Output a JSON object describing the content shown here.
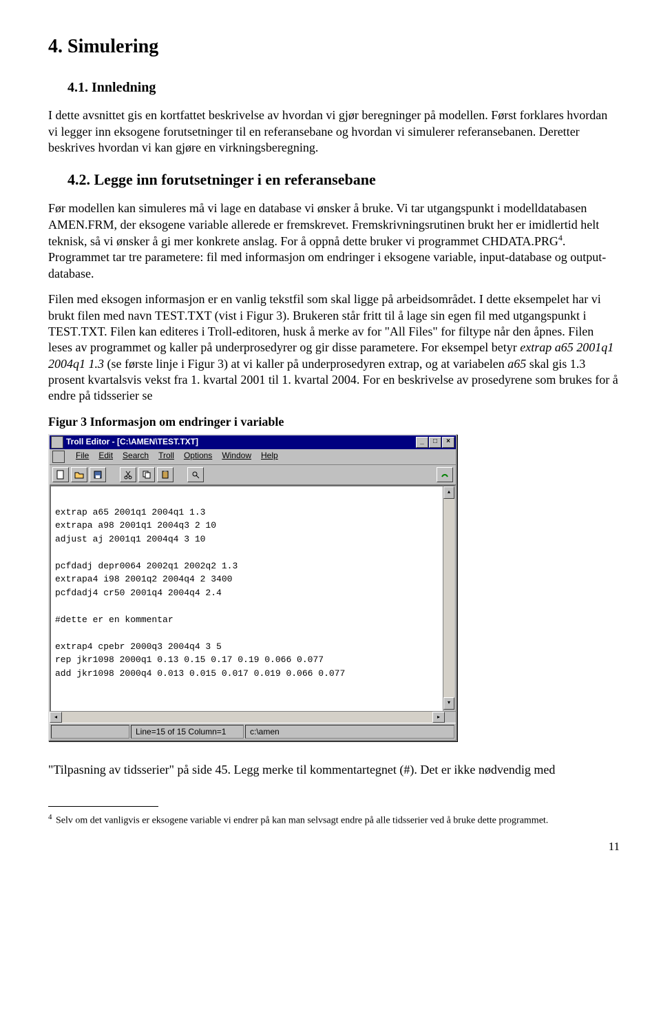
{
  "h1": "4. Simulering",
  "sec41": {
    "title": "4.1.    Innledning",
    "p1": "I dette avsnittet gis en kortfattet beskrivelse av hvordan vi gjør beregninger på modellen. Først forklares hvordan vi legger inn eksogene forutsetninger til en referansebane og hvordan vi simulerer referansebanen. Deretter beskrives hvordan vi kan gjøre en virkningsberegning."
  },
  "sec42": {
    "title": "4.2.    Legge inn forutsetninger i en referansebane",
    "p1a": "Før modellen kan simuleres må vi lage en database vi ønsker å bruke. Vi tar utgangspunkt i modelldatabasen ",
    "amen": "AMEN",
    "frm": ".FRM",
    "p1b": ", der eksogene variable allerede er fremskrevet. Fremskrivningsrutinen brukt her er imidlertid helt teknisk, så vi ønsker å gi mer konkrete anslag. For å oppnå dette bruker vi programmet ",
    "chdata": "CHDATA",
    "prg": ".PRG",
    "fnref": "4",
    "p1c": ". Programmet tar tre parametere: fil med informasjon om endringer i eksogene variable, input-database og output-database.",
    "p2a": "Filen med eksogen informasjon er en vanlig tekstfil som skal ligge på arbeidsområdet. I dette eksempelet har vi brukt filen med navn ",
    "test": "TEST",
    "txt": ".TXT",
    "p2b": " (vist i Figur 3). Brukeren står fritt til å lage sin egen fil med utgangspunkt i ",
    "p2c": ". Filen kan editeres i Troll-editoren, husk å merke av for \"All Files\" for filtype når den åpnes. Filen leses av programmet og kaller på underprosedyrer og gir disse parametere. For eksempel betyr ",
    "extrap_example": "extrap a65 2001q1 2004q1 1.3",
    "p2d": " (se første linje i Figur 3) at vi kaller på underprosedyren extrap, og at variabelen ",
    "a65": "a65",
    "p2e": " skal gis 1.3 prosent kvartalsvis vekst fra 1. kvartal 2001 til 1. kvartal 2004. For en beskrivelse av prosedyrene som brukes for å endre på tidsserier se"
  },
  "figure": {
    "caption": "Figur 3 Informasjon om endringer i variable",
    "window_title": "Troll Editor - [C:\\AMEN\\TEST.TXT]",
    "menus": [
      "File",
      "Edit",
      "Search",
      "Troll",
      "Options",
      "Window",
      "Help"
    ],
    "toolbar_icons": [
      "new",
      "open",
      "save",
      "cut",
      "copy",
      "paste",
      "find",
      "run"
    ],
    "editor_text": "\nextrap a65 2001q1 2004q1 1.3\nextrapa a98 2001q1 2004q3 2 10\nadjust aj 2001q1 2004q4 3 10\n\npcfdadj depr0064 2002q1 2002q2 1.3\nextrapa4 i98 2001q2 2004q4 2 3400\npcfdadj4 cr50 2001q4 2004q4 2.4\n\n#dette er en kommentar\n\nextrap4 cpebr 2000q3 2004q4 3 5\nrep jkr1098 2000q1 0.13 0.15 0.17 0.19 0.066 0.077\nadd jkr1098 2000q4 0.013 0.015 0.017 0.019 0.066 0.077",
    "status_line": "Line=15 of 15  Column=1",
    "status_path": "c:\\amen"
  },
  "after_fig": "\"Tilpasning av tidsserier\" på side 45. Legg merke til kommentartegnet (#). Det er ikke nødvendig med",
  "footnote": {
    "ref": "4",
    "text": " Selv om det vanligvis er eksogene variable vi endrer på kan man selvsagt endre på alle tidsserier ved å bruke dette programmet."
  },
  "page_number": "11"
}
